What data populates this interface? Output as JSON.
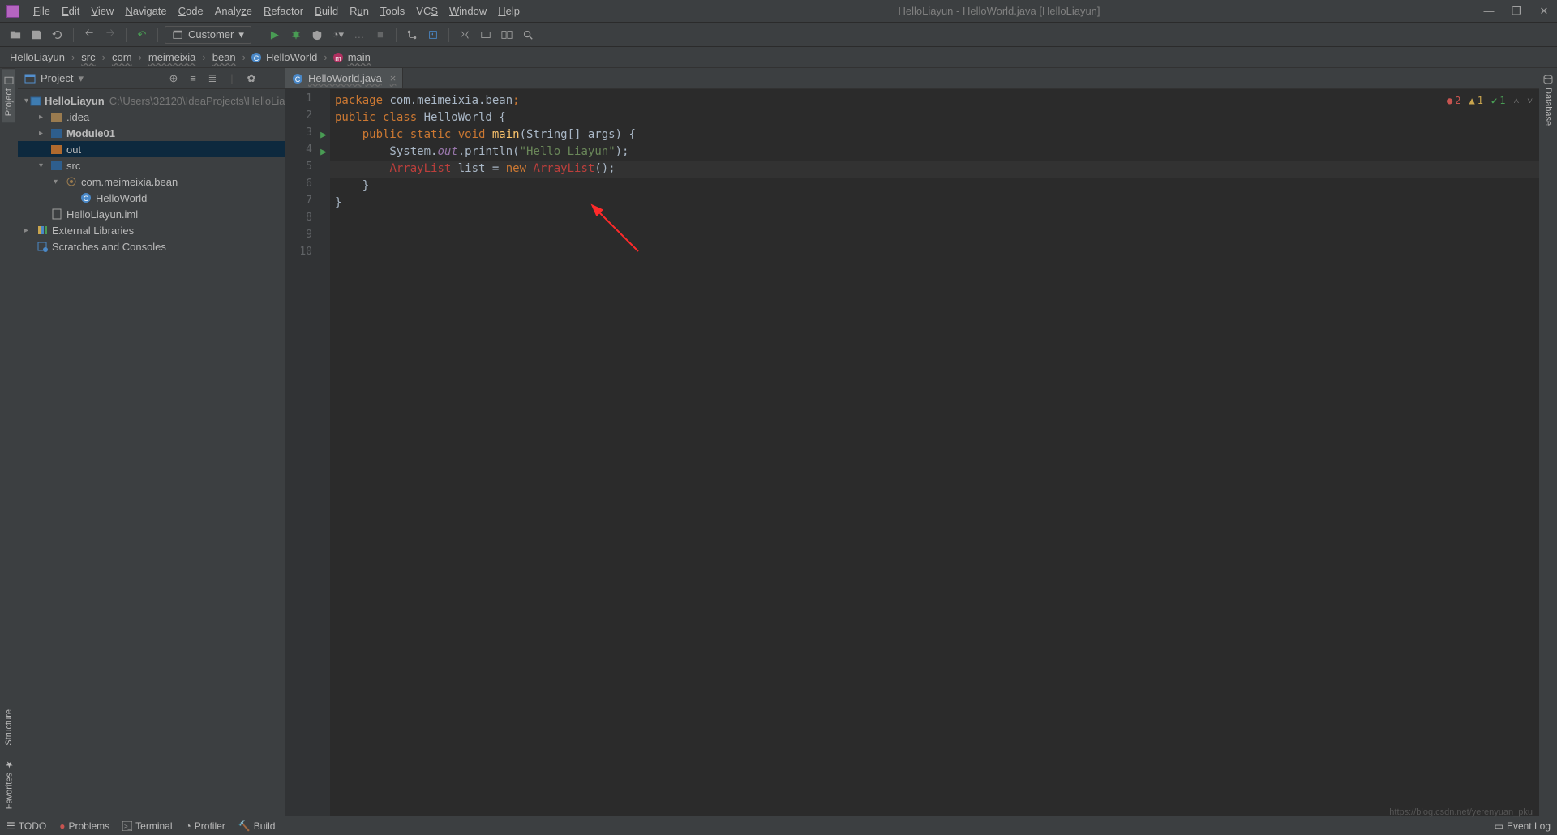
{
  "window": {
    "title": "HelloLiayun - HelloWorld.java [HelloLiayun]"
  },
  "menu": [
    "File",
    "Edit",
    "View",
    "Navigate",
    "Code",
    "Analyze",
    "Refactor",
    "Build",
    "Run",
    "Tools",
    "VCS",
    "Window",
    "Help"
  ],
  "toolbar": {
    "run_config": "Customer"
  },
  "breadcrumbs": [
    {
      "label": "HelloLiayun",
      "wavy": false
    },
    {
      "label": "src",
      "wavy": true
    },
    {
      "label": "com",
      "wavy": true
    },
    {
      "label": "meimeixia",
      "wavy": true
    },
    {
      "label": "bean",
      "wavy": true
    },
    {
      "label": "HelloWorld",
      "wavy": false,
      "icon": "class"
    },
    {
      "label": "main",
      "wavy": true,
      "icon": "method"
    }
  ],
  "project_panel": {
    "title": "Project",
    "tree": [
      {
        "indent": 0,
        "arrow": "▾",
        "icon": "module",
        "label": "HelloLiayun",
        "bold": true,
        "hint": "C:\\Users\\32120\\IdeaProjects\\HelloLia"
      },
      {
        "indent": 1,
        "arrow": "▸",
        "icon": "folder",
        "label": ".idea"
      },
      {
        "indent": 1,
        "arrow": "▸",
        "icon": "folder-blue",
        "label": "Module01",
        "bold": true
      },
      {
        "indent": 1,
        "arrow": "",
        "icon": "folder-orange",
        "label": "out",
        "selected": true
      },
      {
        "indent": 1,
        "arrow": "▾",
        "icon": "folder-blue",
        "label": "src"
      },
      {
        "indent": 2,
        "arrow": "▾",
        "icon": "package",
        "label": "com.meimeixia.bean"
      },
      {
        "indent": 3,
        "arrow": "",
        "icon": "class",
        "label": "HelloWorld"
      },
      {
        "indent": 1,
        "arrow": "",
        "icon": "file",
        "label": "HelloLiayun.iml"
      },
      {
        "indent": 0,
        "arrow": "▸",
        "icon": "libs",
        "label": "External Libraries"
      },
      {
        "indent": 0,
        "arrow": "",
        "icon": "scratches",
        "label": "Scratches and Consoles"
      }
    ]
  },
  "tabs": [
    {
      "label": "HelloWorld.java",
      "icon": "class"
    }
  ],
  "editor": {
    "lines": [
      {
        "n": 1,
        "run": false,
        "tokens": [
          [
            "kw",
            "package "
          ],
          [
            "txt",
            "com.meimeixia.bean"
          ],
          [
            "kw",
            ";"
          ]
        ]
      },
      {
        "n": 2,
        "run": false,
        "tokens": [
          [
            "txt",
            ""
          ]
        ]
      },
      {
        "n": 3,
        "run": true,
        "tokens": [
          [
            "kw",
            "public class "
          ],
          [
            "cls",
            "HelloWorld "
          ],
          [
            "txt",
            "{"
          ]
        ]
      },
      {
        "n": 4,
        "run": true,
        "tokens": [
          [
            "txt",
            "    "
          ],
          [
            "kw",
            "public static void "
          ],
          [
            "fn",
            "main"
          ],
          [
            "txt",
            "(String[] args) {"
          ]
        ]
      },
      {
        "n": 5,
        "run": false,
        "tokens": [
          [
            "txt",
            "        System."
          ],
          [
            "field",
            "out"
          ],
          [
            "txt",
            ".println("
          ],
          [
            "str",
            "\"Hello "
          ],
          [
            "str und",
            "Liayun"
          ],
          [
            "str",
            "\""
          ],
          [
            "txt",
            ");"
          ]
        ]
      },
      {
        "n": 6,
        "run": false,
        "tokens": [
          [
            "txt",
            ""
          ]
        ]
      },
      {
        "n": 7,
        "run": false,
        "highlight": true,
        "tokens": [
          [
            "txt",
            "        "
          ],
          [
            "err",
            "ArrayList"
          ],
          [
            "txt",
            " list "
          ],
          [
            "txt",
            "= "
          ],
          [
            "kw",
            "new "
          ],
          [
            "err",
            "ArrayList"
          ],
          [
            "txt",
            "();"
          ]
        ]
      },
      {
        "n": 8,
        "run": false,
        "tokens": [
          [
            "txt",
            "    }"
          ]
        ]
      },
      {
        "n": 9,
        "run": false,
        "tokens": [
          [
            "txt",
            "}"
          ]
        ]
      },
      {
        "n": 10,
        "run": false,
        "tokens": [
          [
            "txt",
            ""
          ]
        ]
      }
    ]
  },
  "inspections": {
    "errors": "2",
    "warnings": "1",
    "hints": "1"
  },
  "left_strip": {
    "project": "Project",
    "structure": "Structure",
    "favorites": "Favorites"
  },
  "right_strip": {
    "database": "Database"
  },
  "status": {
    "todo": "TODO",
    "problems": "Problems",
    "terminal": "Terminal",
    "profiler": "Profiler",
    "build": "Build",
    "eventlog": "Event Log"
  },
  "watermark": "https://blog.csdn.net/yerenyuan_pku"
}
